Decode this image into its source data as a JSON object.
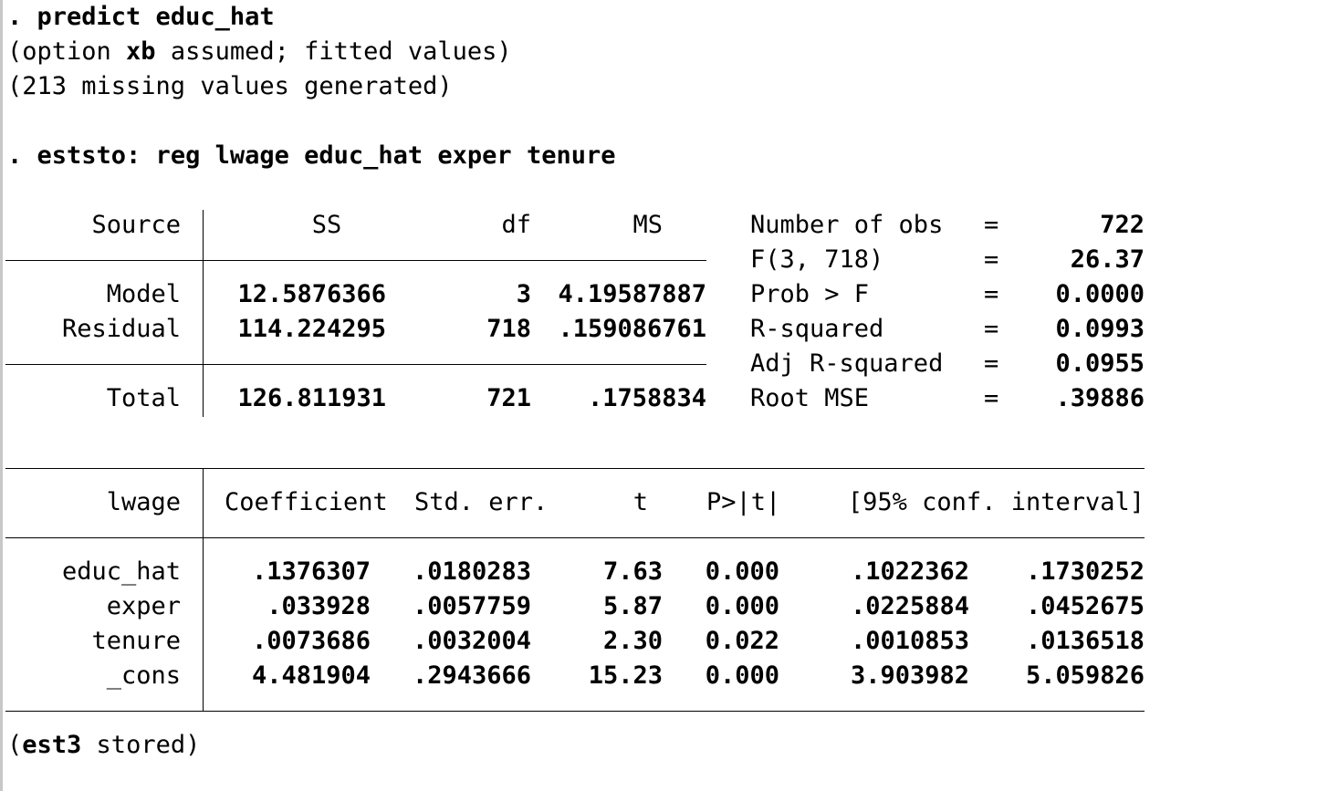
{
  "log": {
    "cmd1_prefix": ". ",
    "cmd1": "predict educ_hat",
    "msg1_open": "(option ",
    "msg1_bold": "xb",
    "msg1_rest": " assumed; fitted values)",
    "msg2": "(213 missing values generated)",
    "cmd2_prefix": ". ",
    "cmd2": "eststo: reg lwage educ_hat exper tenure",
    "stored_open": "(",
    "stored_bold": "est3",
    "stored_rest": " stored)"
  },
  "anova": {
    "headers": {
      "source": "Source",
      "ss": "SS",
      "df": "df",
      "ms": "MS"
    },
    "rows": [
      {
        "source": "Model",
        "ss": "12.5876366",
        "df": "3",
        "ms": "4.19587887"
      },
      {
        "source": "Residual",
        "ss": "114.224295",
        "df": "718",
        "ms": ".159086761"
      }
    ],
    "total": {
      "source": "Total",
      "ss": "126.811931",
      "df": "721",
      "ms": ".1758834"
    }
  },
  "stats": [
    {
      "label": "Number of obs",
      "eq": "=",
      "value": "722"
    },
    {
      "label": "F(3, 718)",
      "eq": "=",
      "value": "26.37"
    },
    {
      "label": "Prob > F",
      "eq": "=",
      "value": "0.0000"
    },
    {
      "label": "R-squared",
      "eq": "=",
      "value": "0.0993"
    },
    {
      "label": "Adj R-squared",
      "eq": "=",
      "value": "0.0955"
    },
    {
      "label": "Root MSE",
      "eq": "=",
      "value": ".39886"
    }
  ],
  "coef": {
    "headers": {
      "depvar": "lwage",
      "coef": "Coefficient",
      "se": "Std. err.",
      "t": "t",
      "p": "P>|t|",
      "ci": "[95% conf. interval]"
    },
    "rows": [
      {
        "var": "educ_hat",
        "coef": ".1376307",
        "se": ".0180283",
        "t": "7.63",
        "p": "0.000",
        "lo": ".1022362",
        "hi": ".1730252"
      },
      {
        "var": "exper",
        "coef": ".033928",
        "se": ".0057759",
        "t": "5.87",
        "p": "0.000",
        "lo": ".0225884",
        "hi": ".0452675"
      },
      {
        "var": "tenure",
        "coef": ".0073686",
        "se": ".0032004",
        "t": "2.30",
        "p": "0.022",
        "lo": ".0010853",
        "hi": ".0136518"
      },
      {
        "var": "_cons",
        "coef": "4.481904",
        "se": ".2943666",
        "t": "15.23",
        "p": "0.000",
        "lo": "3.903982",
        "hi": "5.059826"
      }
    ]
  }
}
